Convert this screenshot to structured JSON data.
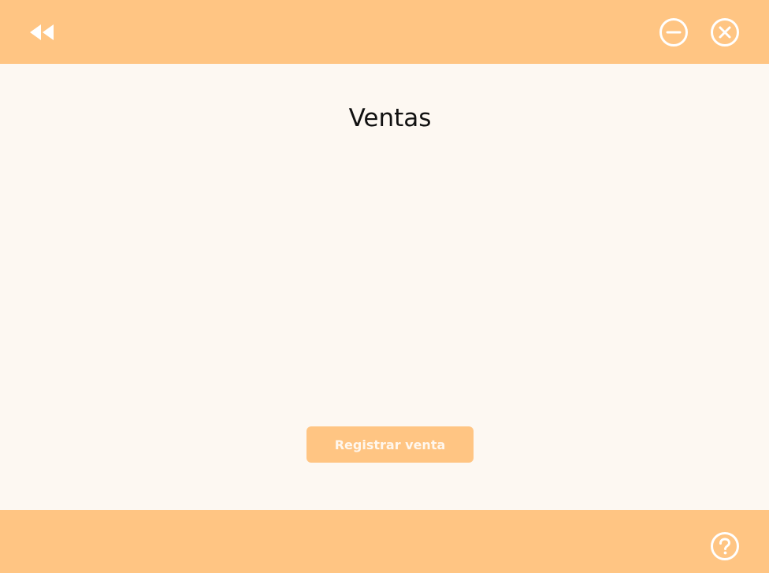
{
  "window": {
    "icons": {
      "back": "rewind-icon",
      "minimize": "minus-circle-icon",
      "close": "x-circle-icon",
      "help": "question-circle-icon"
    }
  },
  "main": {
    "title": "Ventas",
    "register_button_label": "Registrar venta"
  },
  "colors": {
    "bar_background": "#ffc583",
    "page_background": "#fdf8f2",
    "icon_color": "#ffffff",
    "title_color": "#111111"
  }
}
